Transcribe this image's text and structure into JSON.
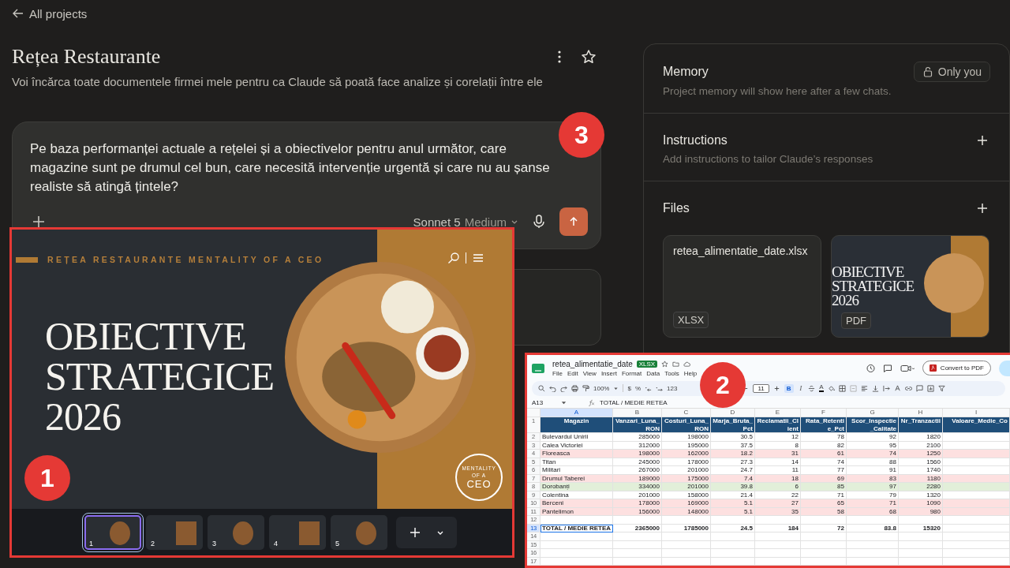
{
  "back_link": "All projects",
  "project": {
    "title": "Rețea Restaurante",
    "description": "Voi încărca toate documentele firmei mele pentru ca Claude să poată face analize și corelații între ele"
  },
  "composer": {
    "value": "Pe baza performanței actuale a rețelei și a obiectivelor pentru anul următor, care magazine sunt pe drumul cel bun, care necesită intervenție urgentă și care nu au șanse realiste să atingă țintele?",
    "model": "Sonnet 5",
    "effort": "Medium"
  },
  "side_panel": {
    "memory": {
      "title": "Memory",
      "badge": "Only you",
      "hint": "Project memory will show here after a few chats."
    },
    "instructions": {
      "title": "Instructions",
      "hint": "Add instructions to tailor Claude’s responses"
    },
    "files": {
      "title": "Files",
      "items": [
        {
          "kind": "text",
          "name": "retea_alimentatie_date.xlsx",
          "type": "XLSX"
        },
        {
          "kind": "preview",
          "title_lines": [
            "OBIECTIVE",
            "STRATEGICE",
            "2026"
          ],
          "type": "PDF"
        }
      ]
    }
  },
  "slide_window": {
    "header": "REȚEA RESTAURANTE MENTALITY OF A CEO",
    "title_lines": [
      "OBIECTIVE",
      "STRATEGICE",
      "2026"
    ],
    "logo_lines": [
      "MENTALITY",
      "OF A",
      "CEO"
    ],
    "thumbnails": [
      {
        "number": "1",
        "selected": true
      },
      {
        "number": "2",
        "selected": false
      },
      {
        "number": "3",
        "selected": false
      },
      {
        "number": "4",
        "selected": false
      },
      {
        "number": "5",
        "selected": false
      }
    ]
  },
  "spreadsheet": {
    "file_name": "retea_alimentatie_date",
    "format": "XLSX",
    "menus": [
      "File",
      "Edit",
      "View",
      "Insert",
      "Format",
      "Data",
      "Tools",
      "Help"
    ],
    "convert_button": "Convert to PDF",
    "zoom": "100%",
    "currency": "$",
    "percent": "%",
    "number_format": "123",
    "font_size": "11",
    "bold": "B",
    "bold_active": true,
    "italic": "I",
    "text_color": "A",
    "cell_ref": "A13",
    "formula": "TOTAL / MEDIE RETEA",
    "column_letters": [
      "A",
      "B",
      "C",
      "D",
      "E",
      "F",
      "G",
      "H",
      "I"
    ],
    "header_row": {
      "number": "1",
      "cells": [
        "Magazin",
        "Vanzari_Luna_RON",
        "Costuri_Luna_RON",
        "Marja_Bruta_Pct",
        "Reclamatii_Client",
        "Rata_Retentie_Pct",
        "Scor_Inspectie_Calitate",
        "Nr_Tranzactii",
        "Valoare_Medie_Co"
      ]
    },
    "rows": [
      {
        "number": "2",
        "kind": "data",
        "color": "#ffffff",
        "selected": false,
        "cells": [
          "Bulevardul Unirii",
          "285000",
          "198000",
          "30.5",
          "12",
          "78",
          "92",
          "1820"
        ]
      },
      {
        "number": "3",
        "kind": "data",
        "color": "#ffffff",
        "selected": false,
        "cells": [
          "Calea Victoriei",
          "312000",
          "195000",
          "37.5",
          "8",
          "82",
          "95",
          "2100"
        ]
      },
      {
        "number": "4",
        "kind": "data",
        "color": "#fde0e0",
        "selected": false,
        "cells": [
          "Floreasca",
          "198000",
          "162000",
          "18.2",
          "31",
          "61",
          "74",
          "1250"
        ]
      },
      {
        "number": "5",
        "kind": "data",
        "color": "#ffffff",
        "selected": false,
        "cells": [
          "Titan",
          "245000",
          "178000",
          "27.3",
          "14",
          "74",
          "88",
          "1560"
        ]
      },
      {
        "number": "6",
        "kind": "data",
        "color": "#ffffff",
        "selected": false,
        "cells": [
          "Militari",
          "267000",
          "201000",
          "24.7",
          "11",
          "77",
          "91",
          "1740"
        ]
      },
      {
        "number": "7",
        "kind": "data",
        "color": "#fde0e0",
        "selected": false,
        "cells": [
          "Drumul Taberei",
          "189000",
          "175000",
          "7.4",
          "18",
          "69",
          "83",
          "1180"
        ]
      },
      {
        "number": "8",
        "kind": "data",
        "color": "#e2efd9",
        "selected": false,
        "cells": [
          "Dorobanți",
          "334000",
          "201000",
          "39.8",
          "6",
          "85",
          "97",
          "2280"
        ]
      },
      {
        "number": "9",
        "kind": "data",
        "color": "#ffffff",
        "selected": false,
        "cells": [
          "Colentina",
          "201000",
          "158000",
          "21.4",
          "22",
          "71",
          "79",
          "1320"
        ]
      },
      {
        "number": "10",
        "kind": "data",
        "color": "#fde0e0",
        "selected": false,
        "cells": [
          "Berceni",
          "178000",
          "169000",
          "5.1",
          "27",
          "65",
          "71",
          "1090"
        ]
      },
      {
        "number": "11",
        "kind": "data",
        "color": "#fde0e0",
        "selected": false,
        "cells": [
          "Pantelimon",
          "156000",
          "148000",
          "5.1",
          "35",
          "58",
          "68",
          "980"
        ]
      },
      {
        "number": "12",
        "kind": "empty",
        "color": "#ffffff",
        "selected": false,
        "cells": []
      },
      {
        "number": "13",
        "kind": "total",
        "color": "#ffffff",
        "selected": true,
        "cells": [
          "TOTAL / MEDIE RETEA",
          "2365000",
          "1785000",
          "24.5",
          "184",
          "72",
          "83.8",
          "15320"
        ]
      },
      {
        "number": "14",
        "kind": "empty",
        "color": "#ffffff",
        "selected": false,
        "cells": []
      },
      {
        "number": "15",
        "kind": "empty",
        "color": "#ffffff",
        "selected": false,
        "cells": []
      },
      {
        "number": "16",
        "kind": "empty",
        "color": "#ffffff",
        "selected": false,
        "cells": []
      },
      {
        "number": "17",
        "kind": "empty",
        "color": "#ffffff",
        "selected": false,
        "cells": []
      }
    ]
  },
  "callouts": [
    {
      "number": "1"
    },
    {
      "number": "2"
    },
    {
      "number": "3"
    }
  ]
}
